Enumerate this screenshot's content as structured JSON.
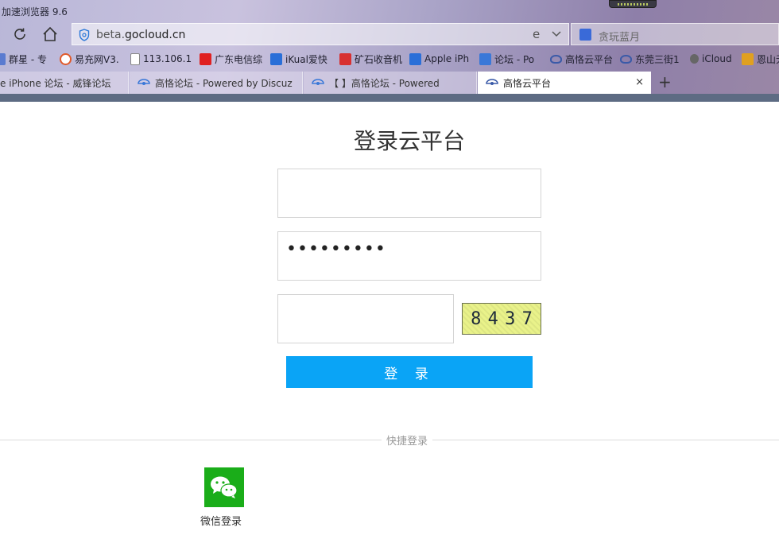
{
  "browser": {
    "app_title": "加速浏览器 9.6",
    "address": {
      "host_prefix": "beta.",
      "host_main": "gocloud.cn"
    },
    "search_placeholder": "贪玩蓝月",
    "bookmarks": [
      {
        "label": "群星 - 专",
        "icon": "page-icon",
        "color": "#5a7bd0"
      },
      {
        "label": "易充网V3.",
        "icon": "ring-icon",
        "color": "#e05a2b"
      },
      {
        "label": "113.106.1",
        "icon": "doc-icon",
        "color": "#ffffff"
      },
      {
        "label": "广东电信综",
        "icon": "s-logo-icon",
        "color": "#e02020"
      },
      {
        "label": "iKual爱快",
        "icon": "ik-logo-icon",
        "color": "#2a6fd8"
      },
      {
        "label": "矿石收音机",
        "icon": "radio-icon",
        "color": "#d83030"
      },
      {
        "label": "Apple iPh",
        "icon": "feng-logo-icon",
        "color": "#2a6fd8"
      },
      {
        "label": "论坛 - Po",
        "icon": "cloud-icon",
        "color": "#3a78d8"
      },
      {
        "label": "高恪云平台",
        "icon": "eye-cloud-icon",
        "color": "#3a5aa8"
      },
      {
        "label": "东莞三街1",
        "icon": "eye-cloud-icon",
        "color": "#3a5aa8"
      },
      {
        "label": "iCloud",
        "icon": "apple-icon",
        "color": "#555555"
      },
      {
        "label": "恩山无",
        "icon": "enshan-icon",
        "color": "#e0a020"
      }
    ],
    "tabs": [
      {
        "label": "e iPhone 论坛 - 威锋论坛",
        "active": false
      },
      {
        "label": "高恪论坛 - Powered by Discuz",
        "active": false
      },
      {
        "label": "【          】高恪论坛 - Powered",
        "active": false
      },
      {
        "label": "高恪云平台",
        "active": true
      }
    ],
    "new_tab": "+",
    "tab_close": "×"
  },
  "login": {
    "title": "登录云平台",
    "username_value": "",
    "password_dots": "•••••••••",
    "captcha_value": "",
    "captcha_text": [
      "8",
      "4",
      "3",
      "7"
    ],
    "submit_label": "登 录",
    "quick_login_label": "快捷登录",
    "wechat_label": "微信登录"
  },
  "colors": {
    "primary_button": "#0aa4f6",
    "wechat_green": "#1aad19",
    "captcha_bg": "#e9f28a"
  }
}
